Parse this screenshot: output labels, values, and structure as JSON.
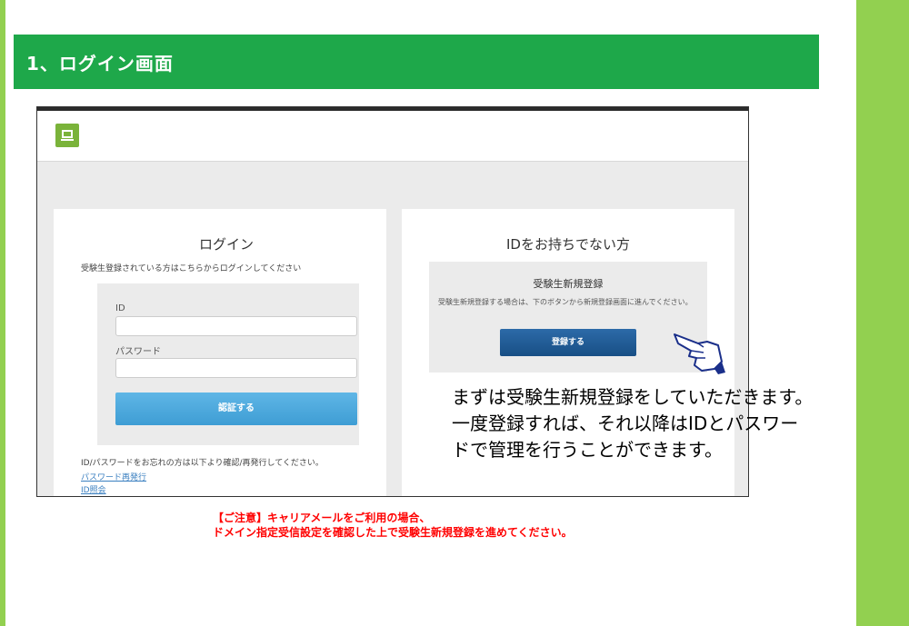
{
  "section": {
    "title": "1、ログイン画面"
  },
  "login": {
    "title": "ログイン",
    "subtitle": "受験生登録されている方はこちらからログインしてください",
    "id_label": "ID",
    "id_value": "",
    "password_label": "パスワード",
    "password_value": "",
    "submit_label": "認証する",
    "forgot_text": "ID/パスワードをお忘れの方は以下より確認/再発行してください。",
    "reset_password_link": "パスワード再発行",
    "id_inquiry_link": "ID照会"
  },
  "register": {
    "title": "IDをお持ちでない方",
    "box_title": "受験生新規登録",
    "description": "受験生新規登録する場合は、下のボタンから新規登録画面に進んでください。",
    "button_label": "登録する"
  },
  "callout": {
    "line1": "まずは受験生新規登録をしていただきます。",
    "line2": "一度登録すれば、それ以降はIDとパスワー",
    "line3": "ドで管理を行うことができます。"
  },
  "notice": {
    "line1": "【ご注意】キャリアメールをご利用の場合、",
    "line2": "ドメイン指定受信設定を確認した上で受験生新規登録を進めてください。"
  },
  "colors": {
    "accent_green": "#1ea84a",
    "side_green": "#92d050",
    "auth_button": "#4ca8dc",
    "register_button": "#1f5c97",
    "notice_red": "#ff0000"
  },
  "icons": {
    "nav": "monitor-icon",
    "pointer": "pointing-hand-icon"
  }
}
